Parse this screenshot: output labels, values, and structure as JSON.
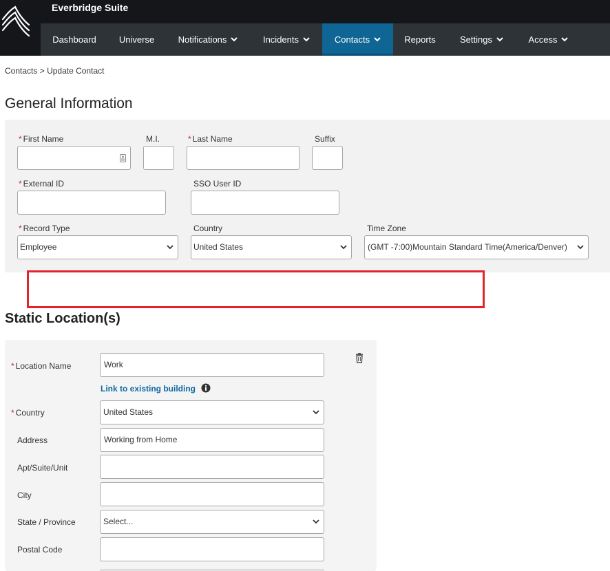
{
  "app": {
    "brand": "Everbridge Suite"
  },
  "nav": [
    {
      "label": "Dashboard",
      "dropdown": false
    },
    {
      "label": "Universe",
      "dropdown": false
    },
    {
      "label": "Notifications",
      "dropdown": true
    },
    {
      "label": "Incidents",
      "dropdown": true
    },
    {
      "label": "Contacts",
      "dropdown": true,
      "active": true
    },
    {
      "label": "Reports",
      "dropdown": false
    },
    {
      "label": "Settings",
      "dropdown": true
    },
    {
      "label": "Access",
      "dropdown": true
    }
  ],
  "breadcrumb": {
    "parent": "Contacts",
    "sep": ">",
    "current": "Update Contact"
  },
  "general": {
    "title": "General Information",
    "first_name_label": "First Name",
    "mi_label": "M.I.",
    "last_name_label": "Last Name",
    "suffix_label": "Suffix",
    "external_id_label": "External ID",
    "sso_label": "SSO User ID",
    "record_type_label": "Record Type",
    "record_type_value": "Employee",
    "country_label": "Country",
    "country_value": "United States",
    "timezone_label": "Time Zone",
    "timezone_value": "(GMT -7:00)Mountain Standard Time(America/Denver)"
  },
  "static": {
    "title": "Static Location(s)",
    "location_name_label": "Location Name",
    "location_name_value": "Work",
    "link_label": "Link to existing building",
    "country_label": "Country",
    "country_value": "United States",
    "address_label": "Address",
    "address_value": "Working from Home",
    "apt_label": "Apt/Suite/Unit",
    "city_label": "City",
    "state_label": "State / Province",
    "state_value": "Select...",
    "postal_label": "Postal Code"
  },
  "colors": {
    "topbar": "#141619",
    "navbar": "#2e3338",
    "active_tab": "#0f6593",
    "required": "#c0272d",
    "highlight_box": "#e32329",
    "link": "#0f6aa3"
  },
  "icons": [
    "everbridge-logo-icon",
    "chevron-down-icon",
    "contact-card-icon",
    "info-icon",
    "trash-icon"
  ]
}
